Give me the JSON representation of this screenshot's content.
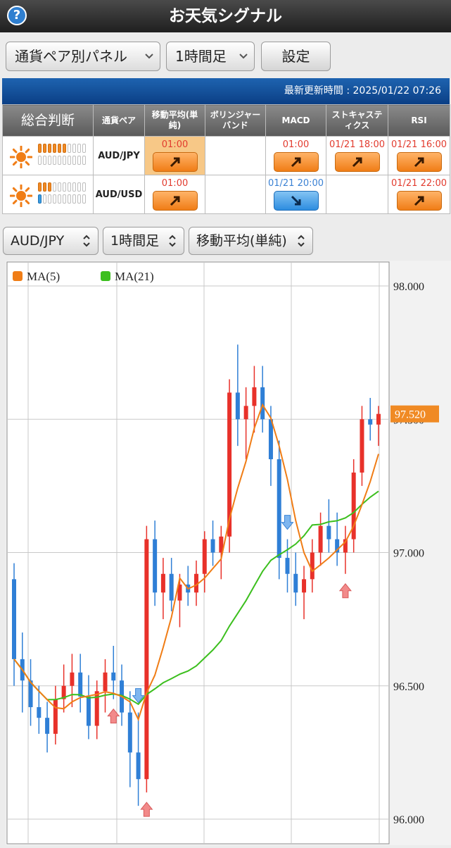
{
  "header": {
    "title": "お天気シグナル",
    "help_icon": "?"
  },
  "controls": {
    "panel_select": "通貨ペア別パネル",
    "timeframe_select": "1時間足",
    "settings_button": "設定"
  },
  "update": {
    "text": "最新更新時間 : 2025/01/22 07:26"
  },
  "table": {
    "headers": [
      "総合判断",
      "通貨ペア",
      "移動平均(単純)",
      "ボリンジャーバンド",
      "MACD",
      "ストキャスティクス",
      "RSI"
    ],
    "rows": [
      {
        "pair": "AUD/JPY",
        "weather_icon": "sun-icon",
        "meter_top": 6,
        "meter_bottom": 0,
        "meter_bottom_color": "blue",
        "signals": [
          {
            "time": "01:00",
            "dir": "up"
          },
          {
            "time": "",
            "dir": ""
          },
          {
            "time": "01:00",
            "dir": "up"
          },
          {
            "time": "01/21 18:00",
            "dir": "up"
          },
          {
            "time": "01/21 16:00",
            "dir": "up"
          }
        ]
      },
      {
        "pair": "AUD/USD",
        "weather_icon": "sun-icon",
        "meter_top": 3,
        "meter_bottom": 1,
        "meter_bottom_color": "blue",
        "signals": [
          {
            "time": "01:00",
            "dir": "up"
          },
          {
            "time": "",
            "dir": ""
          },
          {
            "time": "01/21 20:00",
            "dir": "down"
          },
          {
            "time": "",
            "dir": ""
          },
          {
            "time": "01/21 22:00",
            "dir": "up"
          }
        ]
      }
    ]
  },
  "chart_selectors": {
    "pair": "AUD/JPY",
    "timeframe": "1時間足",
    "indicator": "移動平均(単純)"
  },
  "chart_data": {
    "type": "candlestick",
    "legend": [
      "MA(5)",
      "MA(21)"
    ],
    "colors": {
      "up": "#e8312a",
      "down": "#2f7fd6",
      "ma5": "#f07d16",
      "ma21": "#3cbf1e",
      "price_tag": "#f08a24"
    },
    "ylim": [
      96.0,
      98.0
    ],
    "y_ticks": [
      "98.000",
      "97.500",
      "97.000",
      "96.500",
      "96.000"
    ],
    "current_price": "97.520",
    "candles": [
      [
        96.9,
        96.96,
        96.5,
        96.6
      ],
      [
        96.6,
        96.7,
        96.4,
        96.52
      ],
      [
        96.52,
        96.6,
        96.35,
        96.42
      ],
      [
        96.42,
        96.5,
        96.32,
        96.38
      ],
      [
        96.38,
        96.44,
        96.25,
        96.32
      ],
      [
        96.32,
        96.5,
        96.28,
        96.45
      ],
      [
        96.45,
        96.58,
        96.4,
        96.5
      ],
      [
        96.5,
        96.62,
        96.42,
        96.55
      ],
      [
        96.55,
        96.62,
        96.4,
        96.46
      ],
      [
        96.46,
        96.54,
        96.3,
        96.35
      ],
      [
        96.35,
        96.52,
        96.3,
        96.48
      ],
      [
        96.48,
        96.6,
        96.4,
        96.55
      ],
      [
        96.55,
        96.65,
        96.45,
        96.52
      ],
      [
        96.52,
        96.58,
        96.35,
        96.4
      ],
      [
        96.4,
        96.48,
        96.12,
        96.25
      ],
      [
        96.25,
        96.4,
        96.05,
        96.15
      ],
      [
        96.15,
        97.1,
        96.1,
        97.05
      ],
      [
        97.05,
        97.12,
        96.8,
        96.85
      ],
      [
        96.85,
        96.98,
        96.75,
        96.92
      ],
      [
        96.92,
        96.98,
        96.78,
        96.82
      ],
      [
        96.82,
        96.92,
        96.72,
        96.88
      ],
      [
        96.88,
        96.95,
        96.8,
        96.85
      ],
      [
        96.85,
        96.97,
        96.8,
        96.92
      ],
      [
        96.92,
        97.08,
        96.85,
        97.05
      ],
      [
        97.05,
        97.12,
        96.95,
        97.0
      ],
      [
        97.0,
        97.1,
        96.9,
        97.06
      ],
      [
        97.06,
        97.65,
        97.0,
        97.6
      ],
      [
        97.6,
        97.78,
        97.4,
        97.5
      ],
      [
        97.5,
        97.62,
        97.35,
        97.55
      ],
      [
        97.55,
        97.7,
        97.45,
        97.62
      ],
      [
        97.62,
        97.7,
        97.45,
        97.5
      ],
      [
        97.5,
        97.55,
        97.25,
        97.35
      ],
      [
        97.35,
        97.42,
        96.9,
        96.98
      ],
      [
        96.98,
        97.05,
        96.85,
        96.92
      ],
      [
        96.92,
        97.0,
        96.8,
        96.85
      ],
      [
        96.85,
        96.95,
        96.75,
        96.9
      ],
      [
        96.9,
        97.05,
        96.85,
        97.0
      ],
      [
        97.0,
        97.15,
        96.95,
        97.1
      ],
      [
        97.1,
        97.2,
        97.0,
        97.05
      ],
      [
        97.05,
        97.15,
        96.95,
        97.0
      ],
      [
        97.0,
        97.1,
        96.92,
        97.05
      ],
      [
        97.05,
        97.35,
        97.0,
        97.3
      ],
      [
        97.3,
        97.55,
        97.25,
        97.5
      ],
      [
        97.5,
        97.58,
        97.42,
        97.48
      ],
      [
        97.48,
        97.55,
        97.4,
        97.52
      ]
    ],
    "markers": [
      {
        "index": 12,
        "dir": "up"
      },
      {
        "index": 15,
        "dir": "down"
      },
      {
        "index": 16,
        "dir": "up"
      },
      {
        "index": 33,
        "dir": "down"
      },
      {
        "index": 40,
        "dir": "up"
      }
    ]
  }
}
